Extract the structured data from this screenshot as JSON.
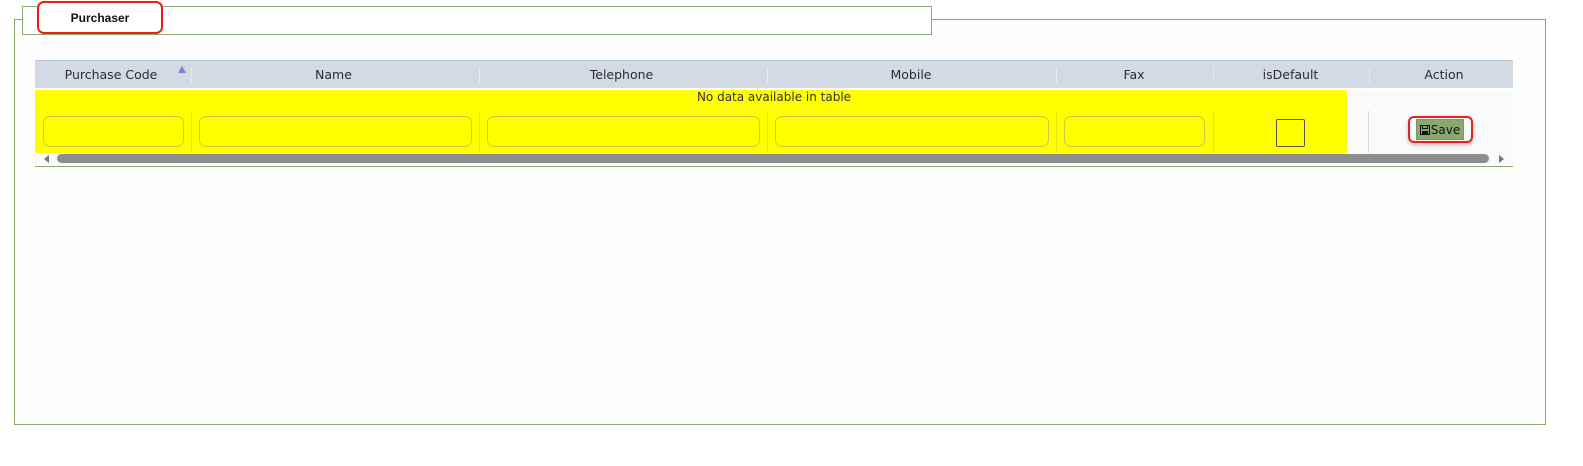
{
  "panel": {
    "tab_label": "Purchaser"
  },
  "table": {
    "columns": [
      {
        "key": "purchase_code",
        "label": "Purchase Code",
        "sorted": "ascending"
      },
      {
        "key": "name",
        "label": "Name"
      },
      {
        "key": "telephone",
        "label": "Telephone"
      },
      {
        "key": "mobile",
        "label": "Mobile"
      },
      {
        "key": "fax",
        "label": "Fax"
      },
      {
        "key": "is_default",
        "label": "isDefault"
      },
      {
        "key": "action",
        "label": "Action"
      }
    ],
    "empty_message": "No data available in table",
    "new_row": {
      "purchase_code": "",
      "name": "",
      "telephone": "",
      "mobile": "",
      "fax": "",
      "is_default": false
    },
    "save_label": "Save",
    "save_icon": "floppy-disk-icon"
  },
  "colors": {
    "highlight_row": "#ffff00",
    "header_bg": "#d2dbe4",
    "panel_border": "#8aab6c",
    "save_button_bg": "#8aa86c",
    "annotation_outline": "#e8201c",
    "sort_indicator": "#7b84d6"
  }
}
